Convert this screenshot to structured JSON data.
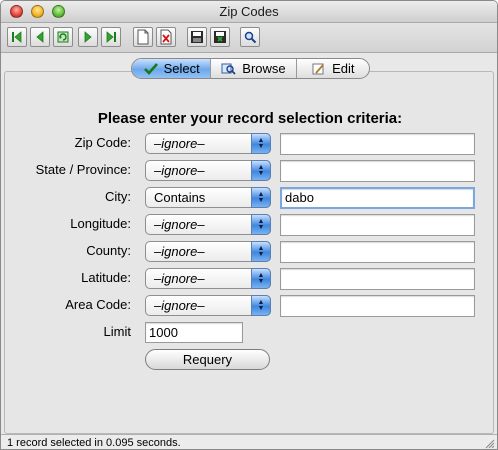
{
  "window": {
    "title": "Zip Codes"
  },
  "toolbar": {
    "buttons": [
      {
        "name": "first-record-icon"
      },
      {
        "name": "prior-record-icon"
      },
      {
        "name": "requery-icon"
      },
      {
        "name": "next-record-icon"
      },
      {
        "name": "last-record-icon"
      },
      {
        "name": "new-record-icon"
      },
      {
        "name": "delete-record-icon"
      },
      {
        "name": "save-icon"
      },
      {
        "name": "cancel-icon"
      },
      {
        "name": "sql-icon"
      }
    ]
  },
  "tabs": [
    {
      "label": "Select",
      "icon": "checkmark-icon",
      "active": true
    },
    {
      "label": "Browse",
      "icon": "magnifier-icon",
      "active": false
    },
    {
      "label": "Edit",
      "icon": "edit-icon",
      "active": false
    }
  ],
  "form": {
    "heading": "Please enter your record selection criteria:",
    "rows": [
      {
        "label": "Zip Code:",
        "operator": "–ignore–",
        "value": ""
      },
      {
        "label": "State / Province:",
        "operator": "–ignore–",
        "value": ""
      },
      {
        "label": "City:",
        "operator": "Contains",
        "value": "dabo"
      },
      {
        "label": "Longitude:",
        "operator": "–ignore–",
        "value": ""
      },
      {
        "label": "County:",
        "operator": "–ignore–",
        "value": ""
      },
      {
        "label": "Latitude:",
        "operator": "–ignore–",
        "value": ""
      },
      {
        "label": "Area Code:",
        "operator": "–ignore–",
        "value": ""
      }
    ],
    "limit_label": "Limit",
    "limit_value": "1000",
    "requery_label": "Requery"
  },
  "status": {
    "text": "1 record selected in 0.095 seconds."
  },
  "colors": {
    "accent": "#4a8fe2",
    "window_bg": "#e8e8e8"
  }
}
